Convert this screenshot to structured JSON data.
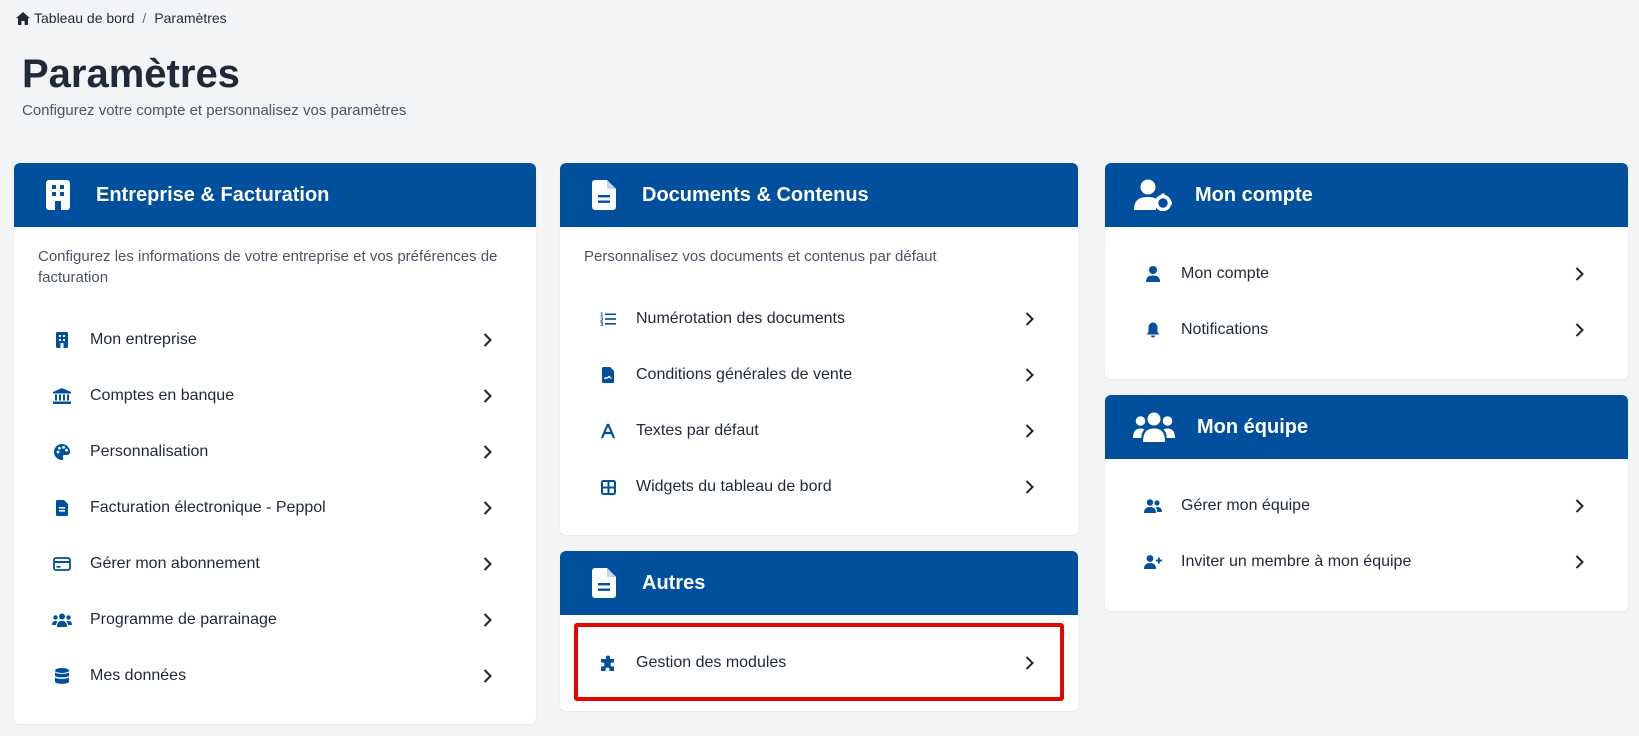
{
  "breadcrumb": {
    "home": "Tableau de bord",
    "separator": "/",
    "current": "Paramètres"
  },
  "header": {
    "title": "Paramètres",
    "subtitle": "Configurez votre compte et personnalisez vos paramètres"
  },
  "colors": {
    "primary": "#00509e",
    "highlight": "#e10600",
    "background": "#f3f4f6"
  },
  "cards": {
    "entreprise": {
      "title": "Entreprise & Facturation",
      "icon": "building-icon",
      "description": "Configurez les informations de votre entreprise et vos préférences de facturation",
      "items": [
        {
          "label": "Mon entreprise",
          "icon": "building-icon"
        },
        {
          "label": "Comptes en banque",
          "icon": "bank-icon"
        },
        {
          "label": "Personnalisation",
          "icon": "palette-icon"
        },
        {
          "label": "Facturation électronique - Peppol",
          "icon": "file-invoice-icon"
        },
        {
          "label": "Gérer mon abonnement",
          "icon": "credit-card-icon"
        },
        {
          "label": "Programme de parrainage",
          "icon": "users-icon"
        },
        {
          "label": "Mes données",
          "icon": "database-icon"
        }
      ]
    },
    "documents": {
      "title": "Documents & Contenus",
      "icon": "file-icon",
      "description": "Personnalisez vos documents et contenus par défaut",
      "items": [
        {
          "label": "Numérotation des documents",
          "icon": "list-ol-icon"
        },
        {
          "label": "Conditions générales de vente",
          "icon": "file-contract-icon"
        },
        {
          "label": "Textes par défaut",
          "icon": "font-icon"
        },
        {
          "label": "Widgets du tableau de bord",
          "icon": "grid-icon"
        }
      ]
    },
    "autres": {
      "title": "Autres",
      "icon": "file-icon",
      "items": [
        {
          "label": "Gestion des modules",
          "icon": "puzzle-icon"
        }
      ]
    },
    "compte": {
      "title": "Mon compte",
      "icon": "user-gear-icon",
      "items": [
        {
          "label": "Mon compte",
          "icon": "user-icon"
        },
        {
          "label": "Notifications",
          "icon": "bell-icon"
        }
      ]
    },
    "equipe": {
      "title": "Mon équipe",
      "icon": "users-icon",
      "items": [
        {
          "label": "Gérer mon équipe",
          "icon": "user-group-icon"
        },
        {
          "label": "Inviter un membre à mon équipe",
          "icon": "user-plus-icon"
        }
      ]
    }
  }
}
